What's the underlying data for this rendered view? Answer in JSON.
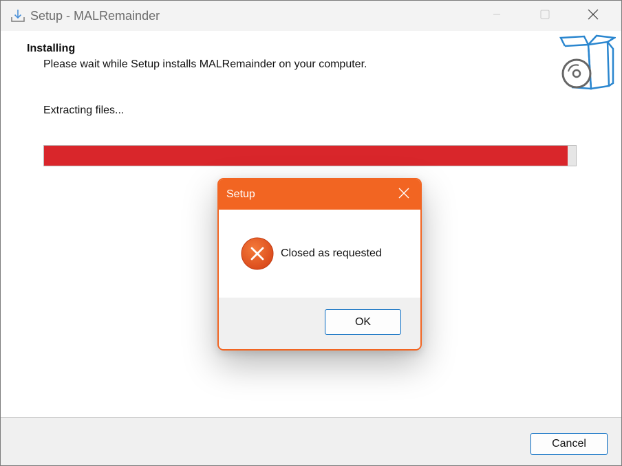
{
  "window": {
    "title": "Setup - MALRemainder",
    "icon": "install-icon",
    "controls": [
      "minimize-icon",
      "maximize-icon",
      "close-icon"
    ]
  },
  "page": {
    "heading": "Installing",
    "subheading": "Please wait while Setup installs MALRemainder on your computer.",
    "status": "Extracting files...",
    "progress": 0.985,
    "progress_color": "#d9262b",
    "side_icon": "software-box-icon"
  },
  "footer": {
    "cancel_label": "Cancel"
  },
  "dialog": {
    "title": "Setup",
    "message": "Closed as requested",
    "icon": "error-icon",
    "ok_label": "OK",
    "accent_color": "#f26522"
  }
}
